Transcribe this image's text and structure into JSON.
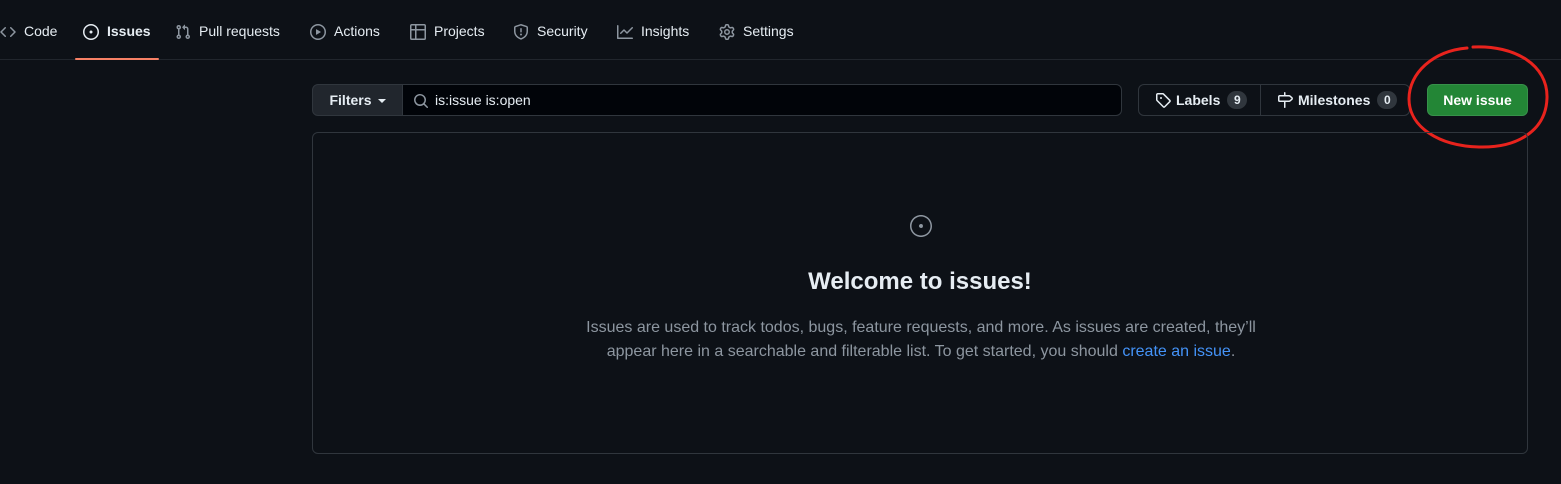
{
  "nav": {
    "tabs": [
      {
        "label": "Code",
        "icon": "code-icon"
      },
      {
        "label": "Issues",
        "icon": "issue-opened-icon",
        "selected": true
      },
      {
        "label": "Pull requests",
        "icon": "git-pull-request-icon"
      },
      {
        "label": "Actions",
        "icon": "play-icon"
      },
      {
        "label": "Projects",
        "icon": "table-icon"
      },
      {
        "label": "Security",
        "icon": "shield-icon"
      },
      {
        "label": "Insights",
        "icon": "graph-icon"
      },
      {
        "label": "Settings",
        "icon": "gear-icon"
      }
    ]
  },
  "toolbar": {
    "filters_label": "Filters",
    "search_value": "is:issue is:open",
    "labels_label": "Labels",
    "labels_count": "9",
    "milestones_label": "Milestones",
    "milestones_count": "0",
    "new_issue_label": "New issue"
  },
  "blankslate": {
    "title": "Welcome to issues!",
    "line1": "Issues are used to track todos, bugs, feature requests, and more. As issues are created, they’ll",
    "line2_prefix": "appear here in a searchable and filterable list. To get started, you should",
    "link_text": "create an issue",
    "line2_suffix": "."
  },
  "colors": {
    "background": "#0d1117",
    "tab_underline": "#f78166",
    "primary_button": "#238636",
    "link": "#4493f8",
    "annotation": "#e8231d"
  }
}
